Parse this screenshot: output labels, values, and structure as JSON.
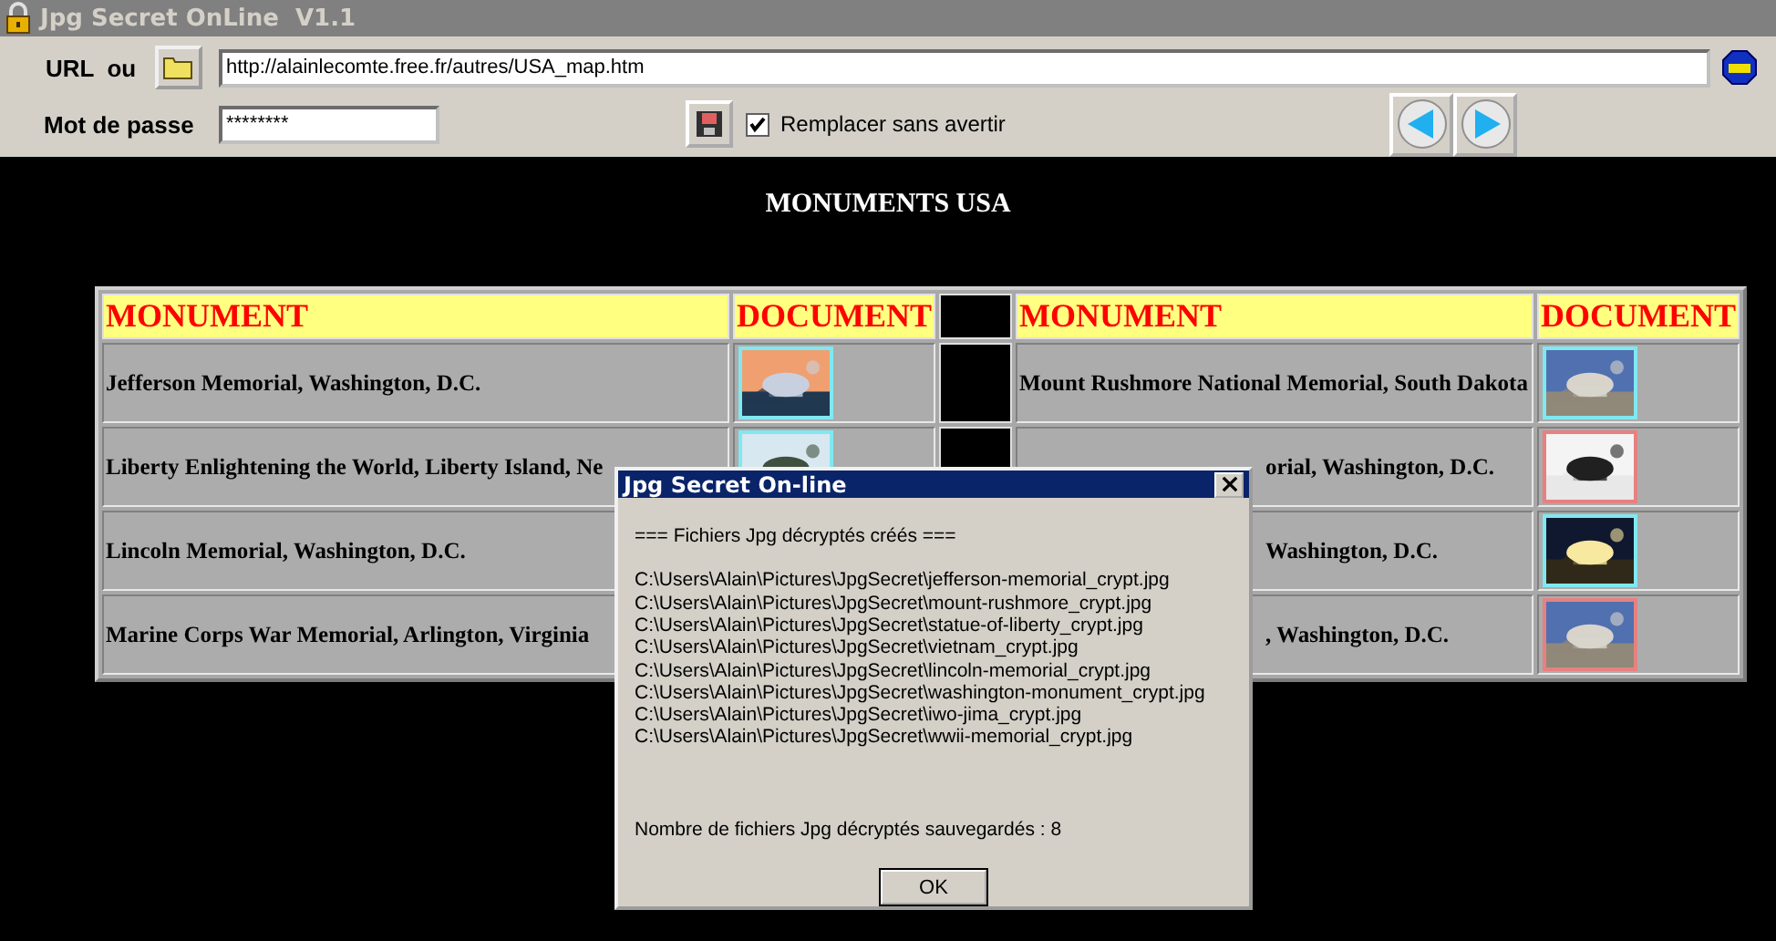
{
  "window": {
    "title": "Jpg Secret OnLine  V1.1"
  },
  "toolbar": {
    "url_label": "URL  ou",
    "url": "http://alainlecomte.free.fr/autres/USA_map.htm",
    "password_label": "Mot de passe",
    "password": "********",
    "replace": {
      "label": "Remplacer sans avertir",
      "checked": true
    }
  },
  "page": {
    "heading": "MONUMENTS USA",
    "table": {
      "columns": [
        "MONUMENT",
        "DOCUMENT",
        "MONUMENT",
        "DOCUMENT"
      ],
      "rows": [
        {
          "left": {
            "monument": "Jefferson Memorial, Washington, D.C."
          },
          "right": {
            "monument": "Mount Rushmore National Memorial, South Dakota",
            "partial": false
          }
        },
        {
          "left": {
            "monument": "Liberty Enlightening the World, Liberty Island, Ne"
          },
          "right": {
            "monument": "orial, Washington, D.C.",
            "partial": true
          }
        },
        {
          "left": {
            "monument": "Lincoln Memorial, Washington, D.C."
          },
          "right": {
            "monument": "Washington, D.C.",
            "partial": true
          }
        },
        {
          "left": {
            "monument": "Marine Corps War Memorial, Arlington, Virginia"
          },
          "right": {
            "monument": ", Washington, D.C.",
            "partial": true
          }
        }
      ]
    }
  },
  "dialog": {
    "title": "Jpg Secret On-line",
    "heading": "=== Fichiers Jpg décryptés créés ===",
    "files": [
      "C:\\Users\\Alain\\Pictures\\JpgSecret\\jefferson-memorial_crypt.jpg",
      "C:\\Users\\Alain\\Pictures\\JpgSecret\\mount-rushmore_crypt.jpg",
      "C:\\Users\\Alain\\Pictures\\JpgSecret\\statue-of-liberty_crypt.jpg",
      "C:\\Users\\Alain\\Pictures\\JpgSecret\\vietnam_crypt.jpg",
      "C:\\Users\\Alain\\Pictures\\JpgSecret\\lincoln-memorial_crypt.jpg",
      "C:\\Users\\Alain\\Pictures\\JpgSecret\\washington-monument_crypt.jpg",
      "C:\\Users\\Alain\\Pictures\\JpgSecret\\iwo-jima_crypt.jpg",
      "C:\\Users\\Alain\\Pictures\\JpgSecret\\wwii-memorial_crypt.jpg"
    ],
    "summary": "Nombre de fichiers Jpg décryptés sauvegardés : 8",
    "button": "OK"
  }
}
